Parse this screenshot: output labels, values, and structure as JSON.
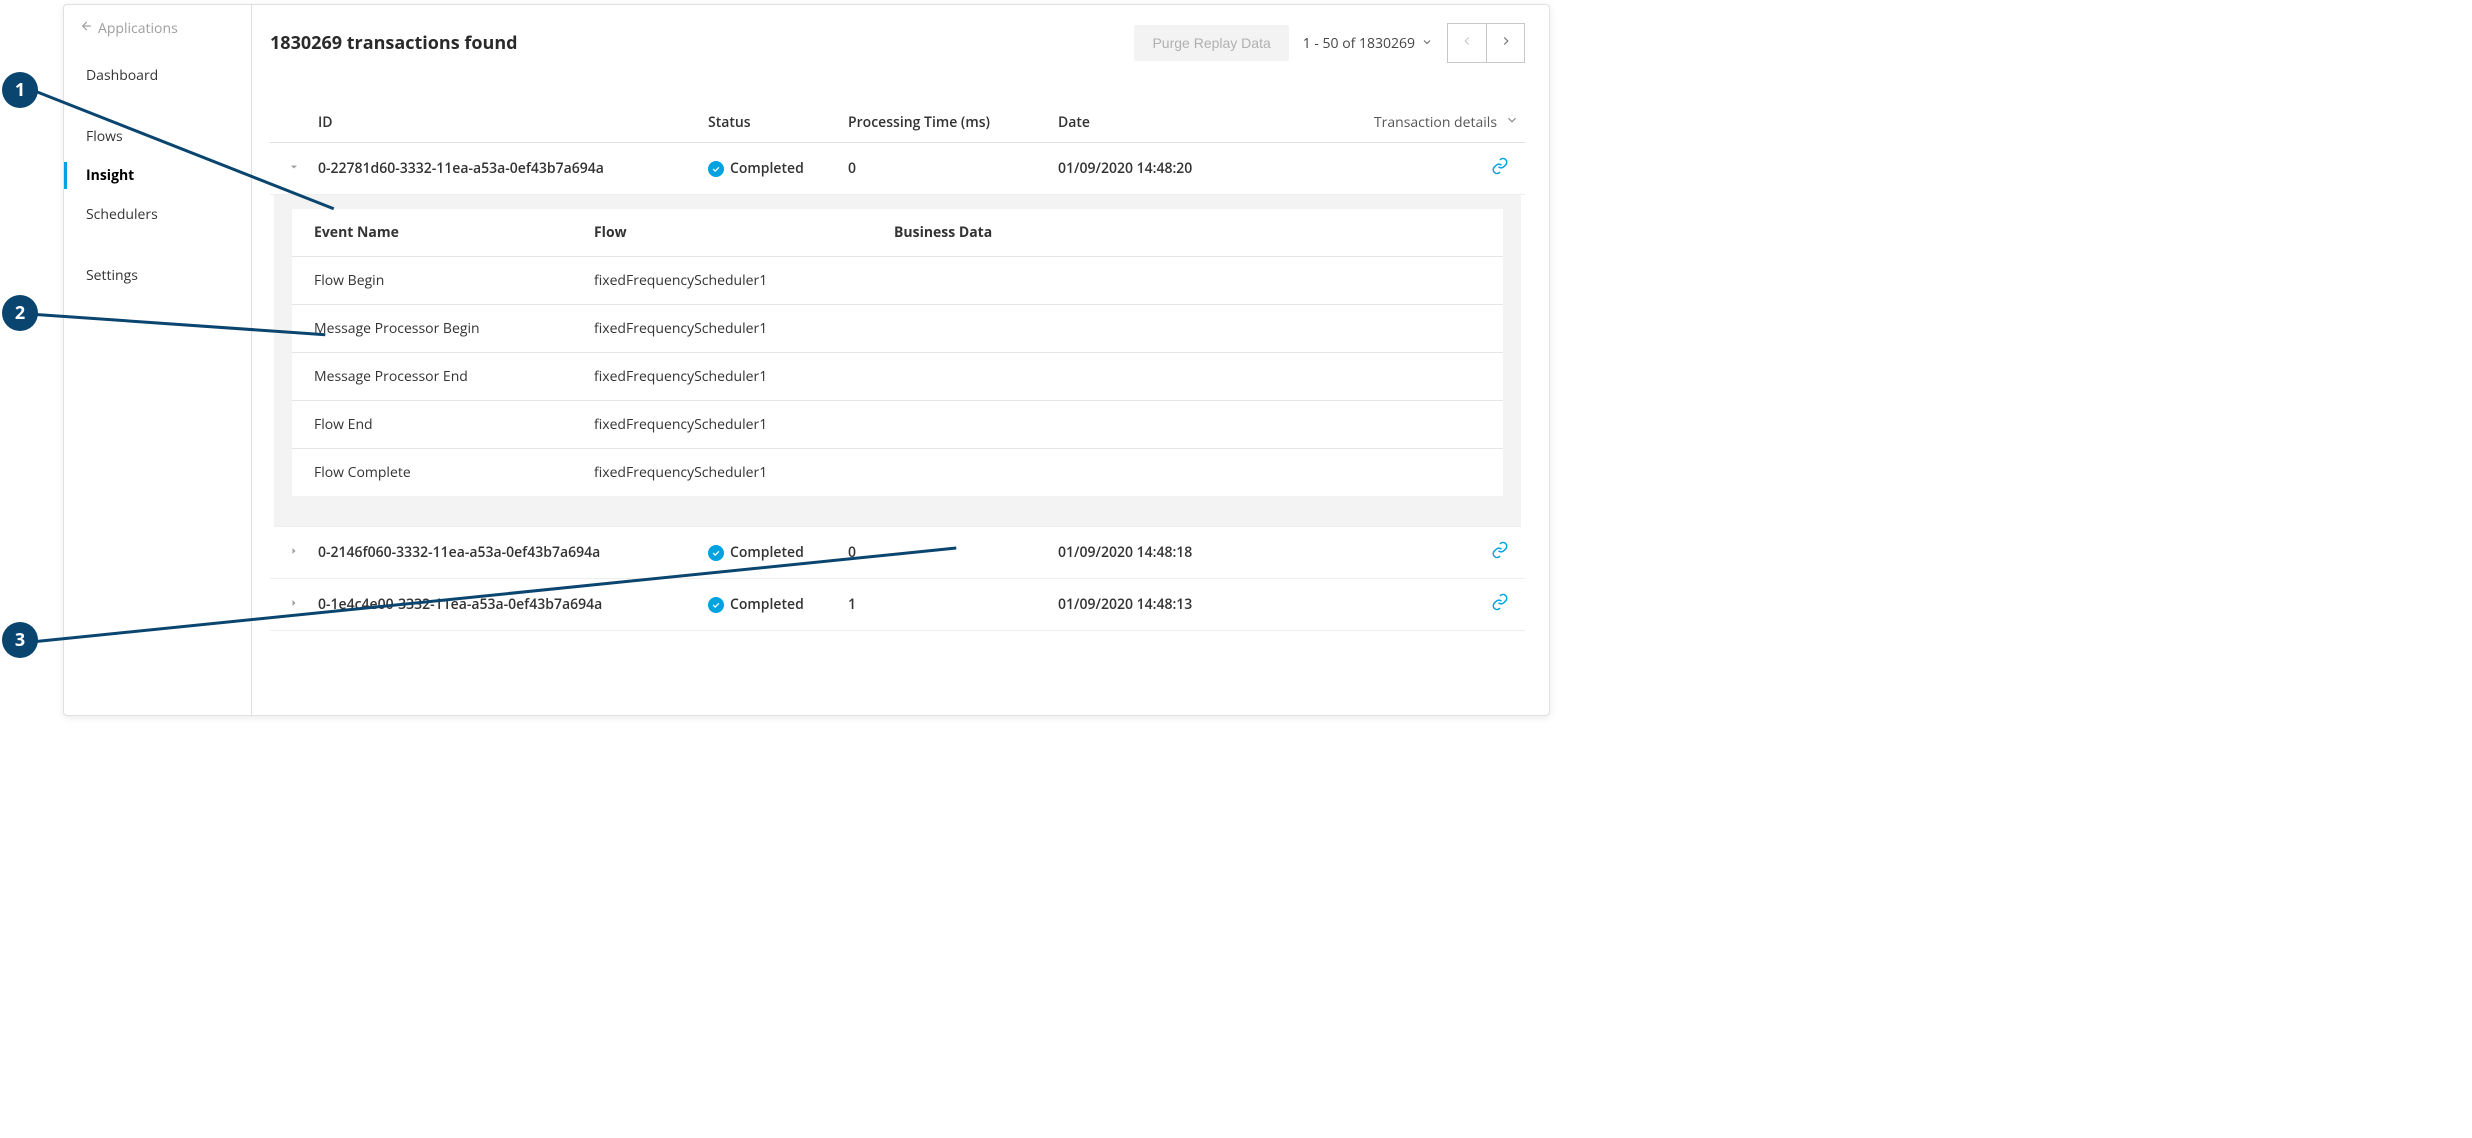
{
  "sidebar": {
    "back_label": "Applications",
    "items": [
      {
        "label": "Dashboard"
      },
      {
        "label": "Flows"
      },
      {
        "label": "Insight",
        "active": true
      },
      {
        "label": "Schedulers"
      }
    ],
    "settings_label": "Settings"
  },
  "header": {
    "title": "1830269 transactions found",
    "purge_label": "Purge Replay Data",
    "pagination_label": "1 - 50 of 1830269"
  },
  "columns": {
    "id": "ID",
    "status": "Status",
    "ptime": "Processing Time (ms)",
    "date": "Date",
    "details_label": "Transaction details"
  },
  "transactions": [
    {
      "id": "0-22781d60-3332-11ea-a53a-0ef43b7a694a",
      "status": "Completed",
      "ptime": "0",
      "date": "01/09/2020 14:48:20",
      "expanded": true,
      "events": [
        {
          "name": "Flow Begin",
          "flow": "fixedFrequencyScheduler1",
          "biz": ""
        },
        {
          "name": "Message Processor Begin",
          "flow": "fixedFrequencyScheduler1",
          "biz": ""
        },
        {
          "name": "Message Processor End",
          "flow": "fixedFrequencyScheduler1",
          "biz": ""
        },
        {
          "name": "Flow End",
          "flow": "fixedFrequencyScheduler1",
          "biz": ""
        },
        {
          "name": "Flow Complete",
          "flow": "fixedFrequencyScheduler1",
          "biz": ""
        }
      ]
    },
    {
      "id": "0-2146f060-3332-11ea-a53a-0ef43b7a694a",
      "status": "Completed",
      "ptime": "0",
      "date": "01/09/2020 14:48:18",
      "expanded": false
    },
    {
      "id": "0-1e4c4e00-3332-11ea-a53a-0ef43b7a694a",
      "status": "Completed",
      "ptime": "1",
      "date": "01/09/2020 14:48:13",
      "expanded": false
    }
  ],
  "sub_columns": {
    "event": "Event Name",
    "flow": "Flow",
    "biz": "Business Data"
  },
  "callouts": [
    "1",
    "2",
    "3"
  ]
}
